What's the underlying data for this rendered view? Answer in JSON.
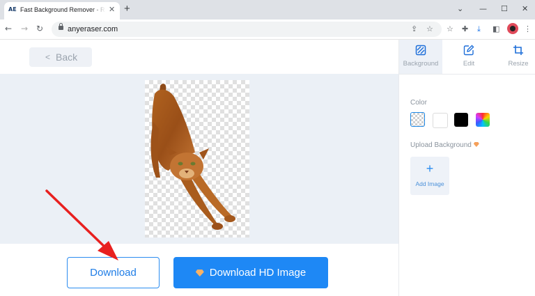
{
  "browser": {
    "tab_title": "Fast Background Remover - R",
    "favicon_text": "AE",
    "url": "anyeraser.com"
  },
  "header": {
    "back_label": "Back"
  },
  "side_panel": {
    "tabs": [
      {
        "label": "Background",
        "icon": "background-icon",
        "active": true
      },
      {
        "label": "Edit",
        "icon": "edit-icon",
        "active": false
      },
      {
        "label": "Resize",
        "icon": "crop-icon",
        "active": false
      }
    ],
    "color_label": "Color",
    "color_options": [
      "transparent",
      "#ffffff",
      "#000000",
      "rainbow"
    ],
    "upload_label": "Upload Background",
    "add_image_label": "Add Image"
  },
  "actions": {
    "download_label": "Download",
    "download_hd_label": "Download HD Image"
  },
  "colors": {
    "accent": "#1e88f5",
    "annotation_arrow": "#e8201f"
  }
}
